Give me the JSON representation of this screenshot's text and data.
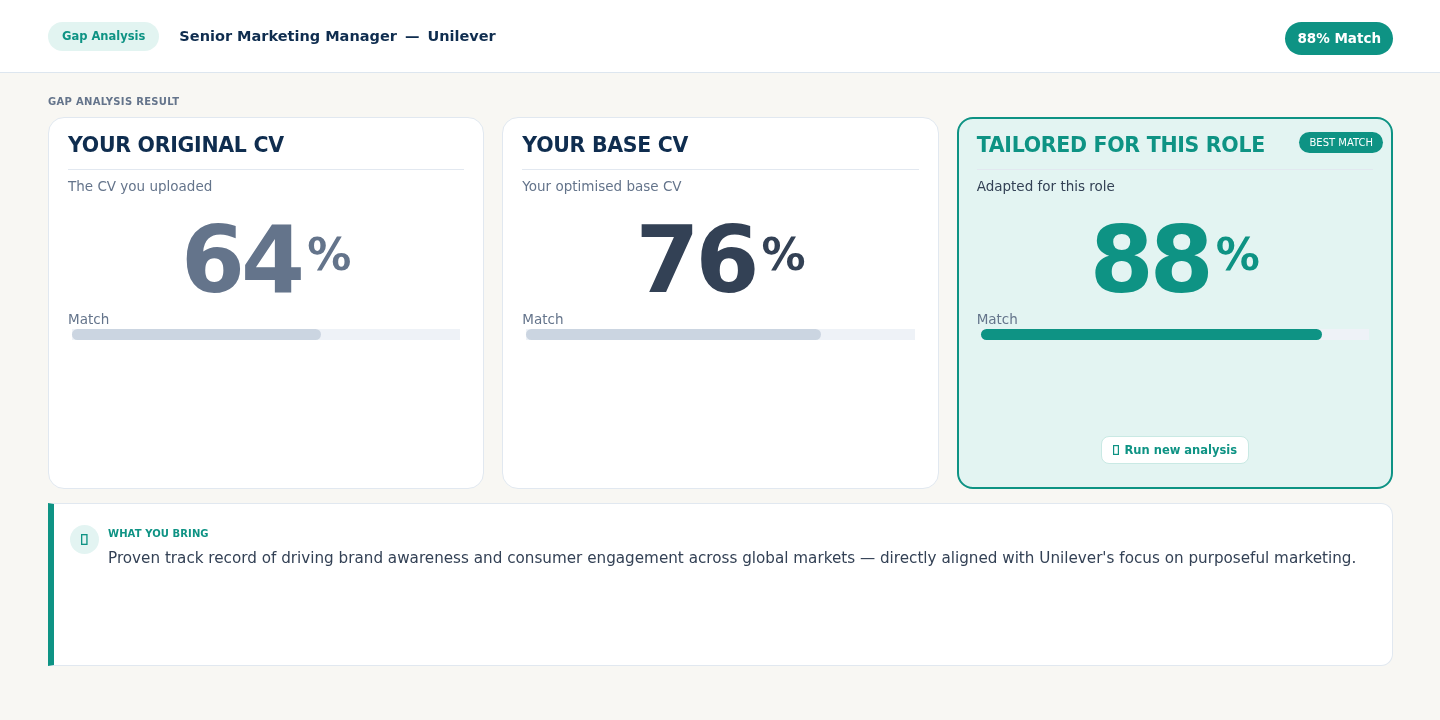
{
  "header": {
    "tag": "Gap Analysis",
    "role": "Senior Marketing Manager",
    "separator": "—",
    "company": "Unilever",
    "match_badge": "88% Match"
  },
  "section_label": "GAP ANALYSIS RESULT",
  "cards": [
    {
      "kind": "original",
      "title": "YOUR ORIGINAL CV",
      "subtitle": "The CV you uploaded",
      "score": "64",
      "unit": "%",
      "meter_label": "Match",
      "level": 0.64
    },
    {
      "kind": "base",
      "title": "YOUR BASE CV",
      "subtitle": "Your optimised base CV",
      "score": "76",
      "unit": "%",
      "meter_label": "Match",
      "level": 0.76
    },
    {
      "kind": "tailored",
      "title": "TAILORED FOR THIS ROLE",
      "badge": "BEST MATCH",
      "subtitle": "Adapted for this role",
      "score": "88",
      "unit": "%",
      "meter_label": "Match",
      "level": 0.88,
      "action": "Run new analysis"
    }
  ],
  "insight": {
    "heading": "WHAT YOU BRING",
    "text": "Proven track record of driving brand awareness and consumer engagement across global markets — directly aligned with Unilever's focus on purposeful marketing."
  }
}
